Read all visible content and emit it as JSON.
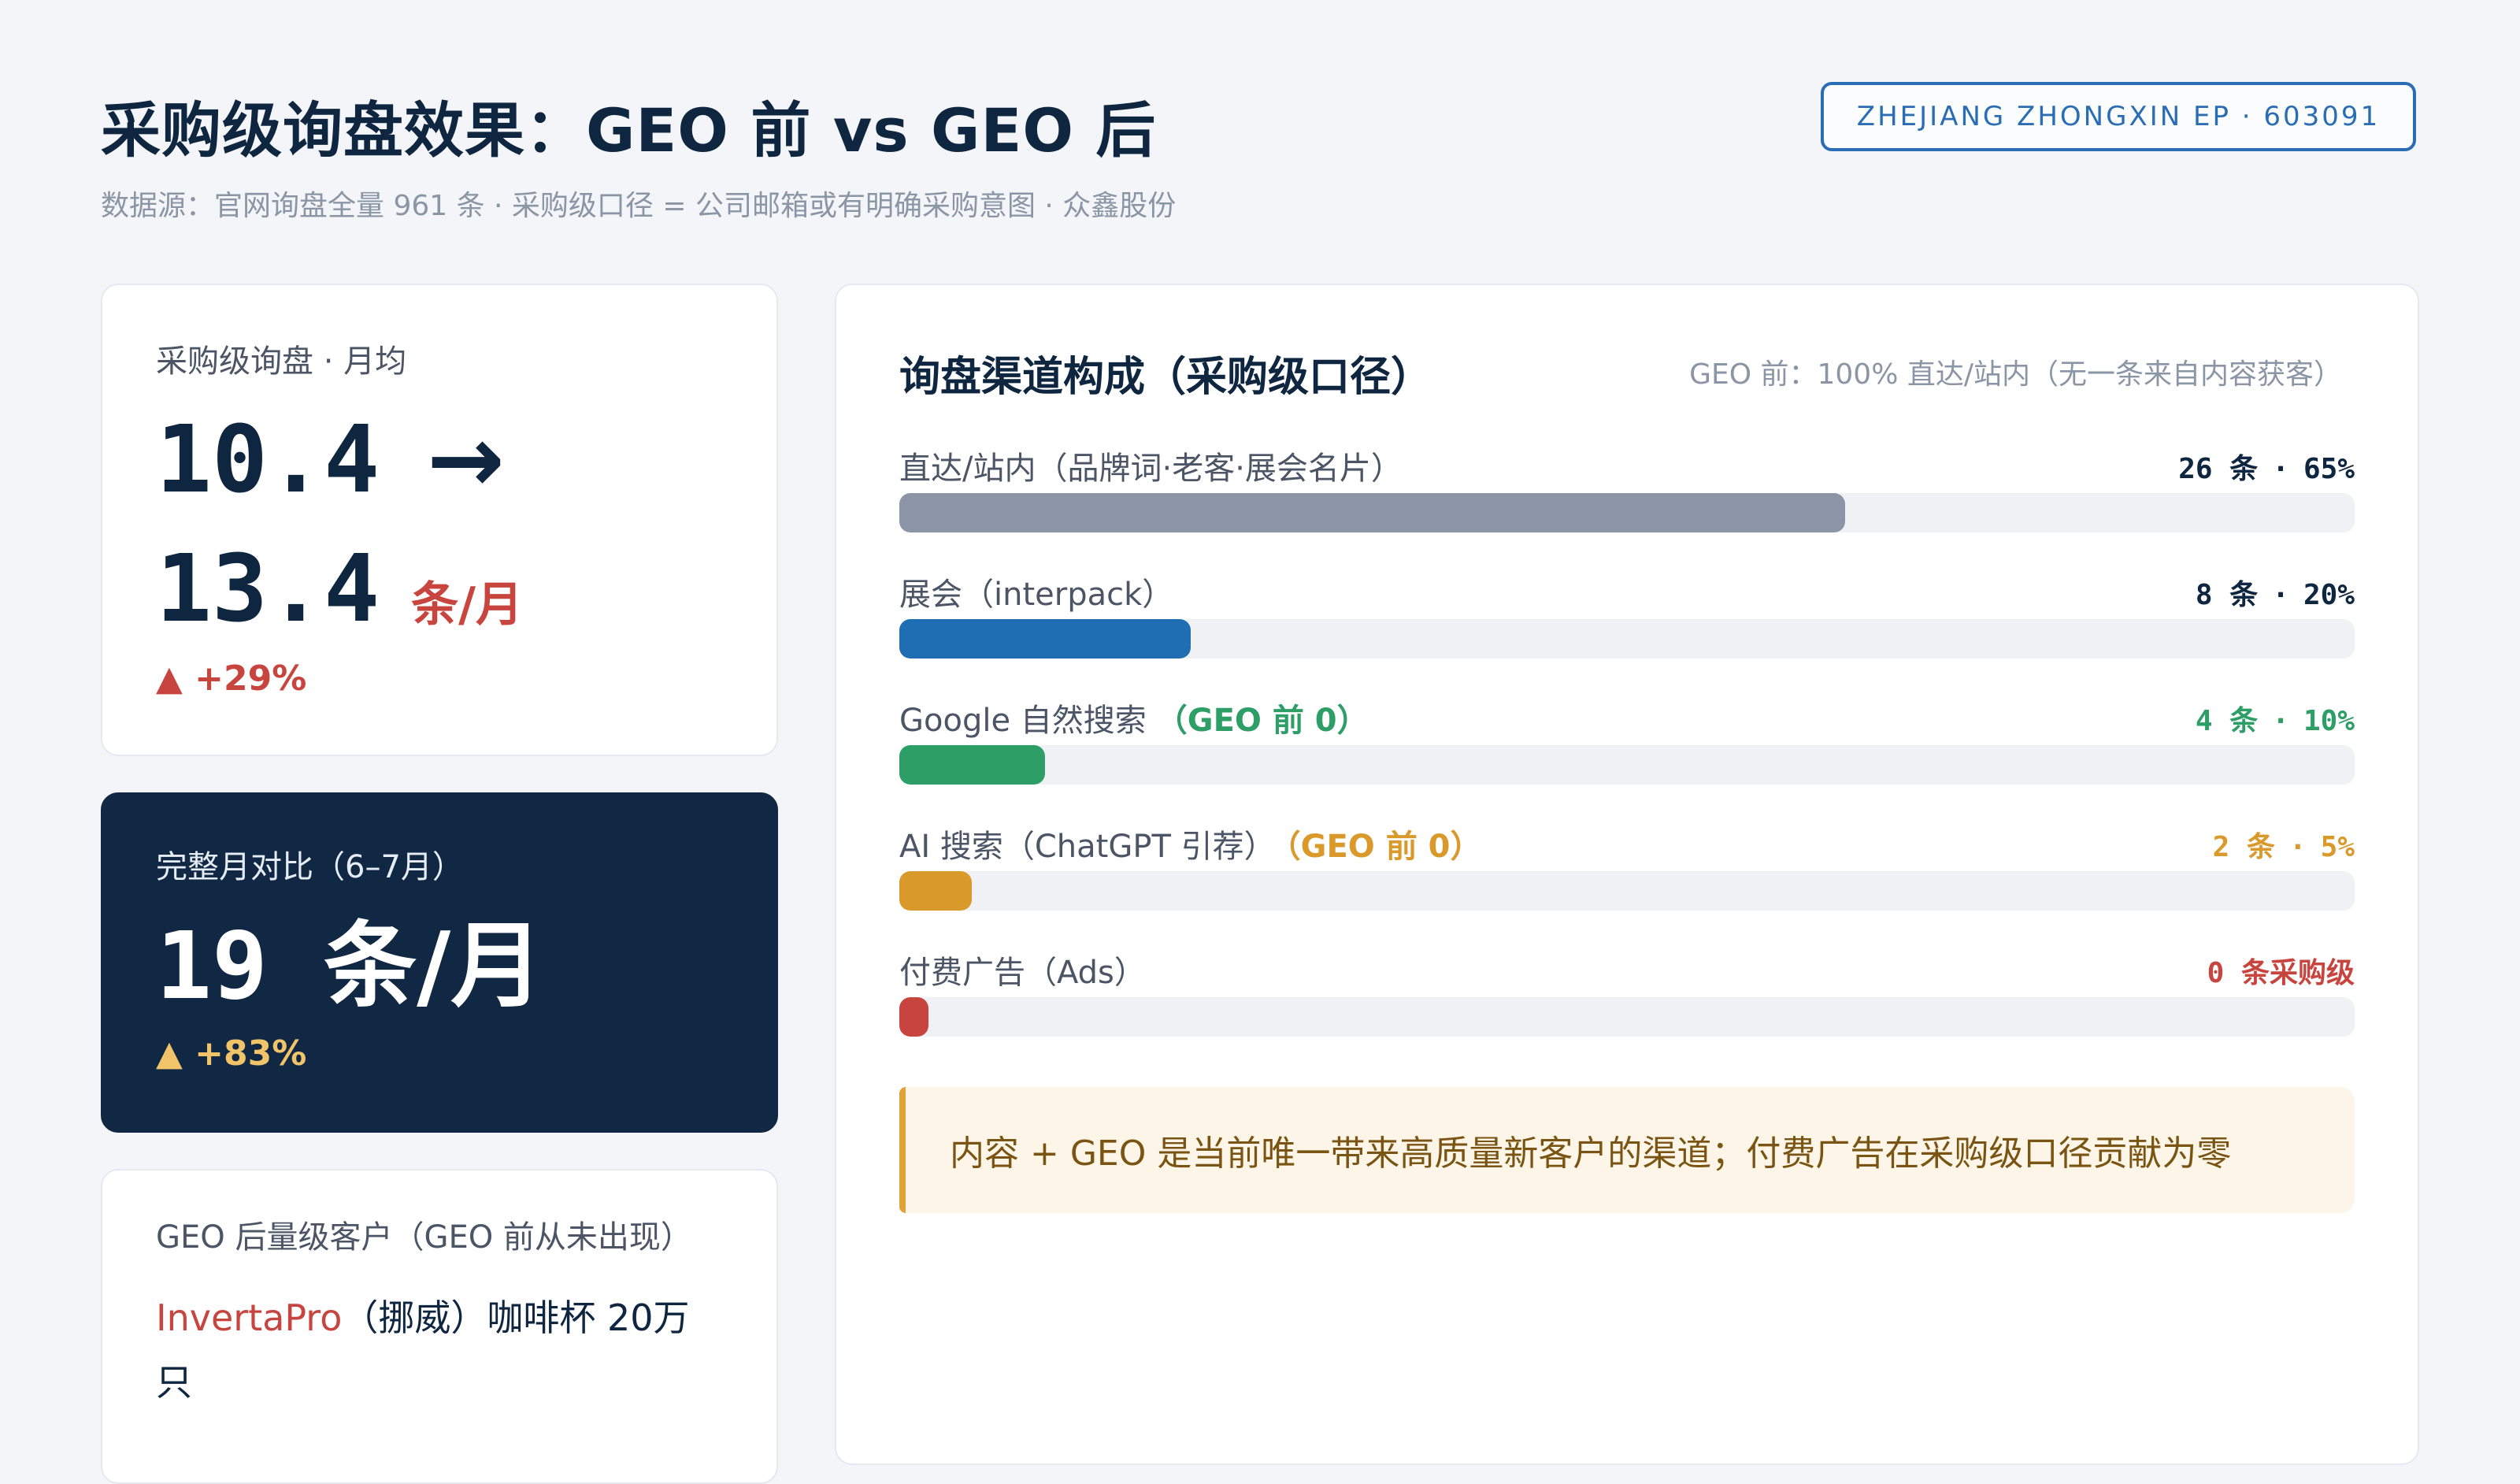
{
  "header": {
    "title": "采购级询盘效果：GEO 前 vs GEO 后",
    "subtitle": "数据源：官网询盘全量 961 条 · 采购级口径 = 公司邮箱或有明确采购意图 · 众鑫股份",
    "badge": "ZHEJIANG ZHONGXIN EP · 603091"
  },
  "monthly_card": {
    "label": "采购级询盘 · 月均",
    "before": "10.4",
    "arrow": "→",
    "after": "13.4",
    "unit": "条/月",
    "delta": "▲ +29%"
  },
  "full_month_card": {
    "label": "完整月对比（6–7月）",
    "value": "19",
    "unit": "条/月",
    "delta": "▲ +83%"
  },
  "clients_card": {
    "label": "GEO 后量级客户（GEO 前从未出现）",
    "client_name": "InvertaPro",
    "client_detail": "（挪威）咖啡杯 20万只"
  },
  "channels": {
    "title": "询盘渠道构成（采购级口径）",
    "note": "GEO 前：100% 直达/站内（无一条来自内容获客）",
    "rows": [
      {
        "name": "直达/站内（品牌词·老客·展会名片）",
        "tag": "",
        "count": "26 条",
        "sep": "·",
        "pct": "65%",
        "share": 0.65,
        "color": "#8b95a6",
        "val_color": "#0f2640"
      },
      {
        "name": "展会（interpack）",
        "tag": "",
        "count": "8 条",
        "sep": "·",
        "pct": "20%",
        "share": 0.2,
        "color": "#1f6db3",
        "val_color": "#0f2640"
      },
      {
        "name": "Google 自然搜索",
        "tag": "（GEO 前 0）",
        "count": "4 条",
        "sep": "·",
        "pct": "10%",
        "share": 0.1,
        "color": "#2e9e67",
        "val_color": "#2e9e67"
      },
      {
        "name": "AI 搜索（ChatGPT 引荐）",
        "tag": "（GEO 前 0）",
        "count": "2 条",
        "sep": "·",
        "pct": "5%",
        "share": 0.05,
        "color": "#d99a2b",
        "val_color": "#d99a2b"
      },
      {
        "name": "付费广告（Ads）",
        "tag": "",
        "count": "0 条采购级",
        "sep": "",
        "pct": "",
        "share": 0.02,
        "color": "#c8453f",
        "val_color": "#c8453f"
      }
    ],
    "callout": "内容 + GEO 是当前唯一带来高质量新客户的渠道；付费广告在采购级口径贡献为零"
  }
}
